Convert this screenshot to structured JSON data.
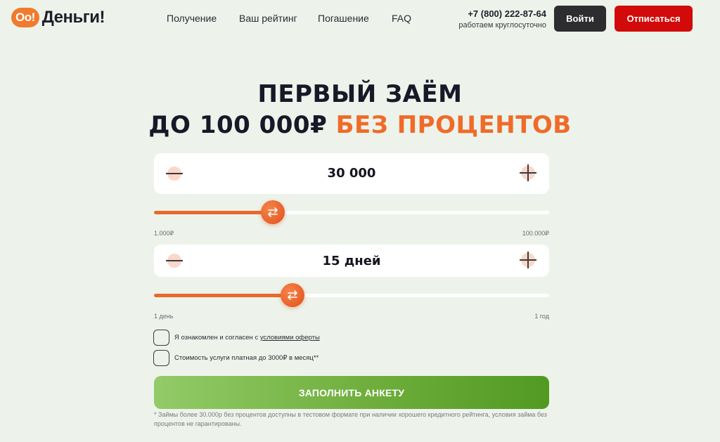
{
  "header": {
    "logo_badge": "Oo!",
    "logo_text": "Деньги!",
    "nav": [
      "Получение",
      "Ваш рейтинг",
      "Погашение",
      "FAQ"
    ],
    "phone": "+7 (800) 222-87-64",
    "hours": "работаем круглосуточно",
    "login_label": "Войти",
    "unsubscribe_label": "Отписаться"
  },
  "hero": {
    "line1": "ПЕРВЫЙ ЗАЁМ",
    "line2_main": "ДО 100 000₽",
    "line2_accent": "БЕЗ ПРОЦЕНТОВ"
  },
  "amount": {
    "value": "30 000",
    "min_label": "1.000₽",
    "max_label": "100.000₽",
    "slider_fraction": 0.3
  },
  "term": {
    "value": "15 дней",
    "min_label": "1 день",
    "max_label": "1 год",
    "slider_fraction": 0.35
  },
  "checks": {
    "agree_prefix": "Я ознакомлен и согласен с",
    "agree_link": "условиями оферты",
    "fee": "Стоимость услуги платная до 3000₽ в месяц**"
  },
  "cta_label": "ЗАПОЛНИТЬ АНКЕТУ",
  "footnote": "* Займы более 30.000р без процентов доступны в тестовом формате при наличии хорошего кредитного рейтинга, условия займа без процентов не гарантированы.",
  "colors": {
    "accent": "#ef6b29",
    "background": "#edf3ea",
    "unsubscribe": "#d20a0a",
    "cta": "#6fae3c"
  }
}
